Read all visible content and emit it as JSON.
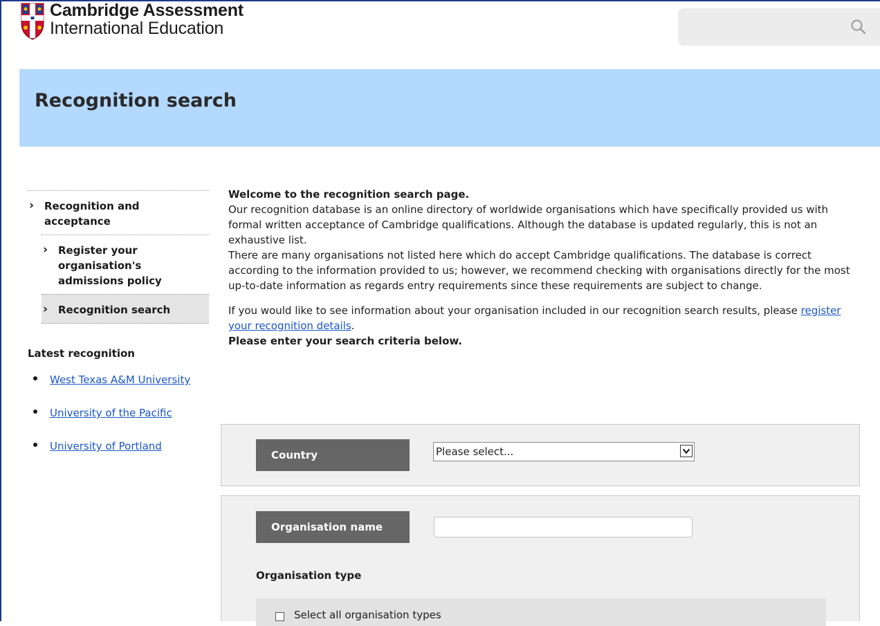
{
  "header": {
    "logo_line1": "Cambridge Assessment",
    "logo_line2": "International Education",
    "search_placeholder": ""
  },
  "banner": {
    "title": "Recognition search"
  },
  "sidebar": {
    "items": [
      {
        "label": "Recognition and acceptance",
        "level": 1,
        "active": false
      },
      {
        "label": "Register your organisation's admissions policy",
        "level": 2,
        "active": false
      },
      {
        "label": "Recognition search",
        "level": 2,
        "active": true
      }
    ],
    "latest_title": "Latest recognition",
    "latest": [
      {
        "label": "West Texas A&M University"
      },
      {
        "label": "University of the Pacific"
      },
      {
        "label": "University of Portland"
      }
    ]
  },
  "main": {
    "welcome": "Welcome to the recognition search page.",
    "intro_p1": "Our recognition database is an online directory of worldwide organisations which have specifically provided us with formal written acceptance of Cambridge qualifications. Although the database is updated regularly, this is not an exhaustive list.",
    "intro_p2": "There are many organisations not listed here which do accept Cambridge qualifications. The database is correct according to the information provided to us; however, we recommend checking with organisations directly for the most up-to-date information as regards entry requirements since these requirements are subject to change.",
    "register_text": "If you would like to see information about your organisation included in our recognition search results, please",
    "register_link": "register your recognition details",
    "register_suffix": ".",
    "enter_criteria": "Please enter your search criteria below."
  },
  "form": {
    "country_label": "Country",
    "country_selected": "Please select...",
    "org_name_label": "Organisation name",
    "org_name_value": "",
    "org_type_label": "Organisation type",
    "select_all_label": "Select all organisation types"
  },
  "colors": {
    "banner": "#b3d9ff",
    "label_box": "#666666",
    "link": "#1a56c8",
    "panel": "#f0f0f0"
  }
}
